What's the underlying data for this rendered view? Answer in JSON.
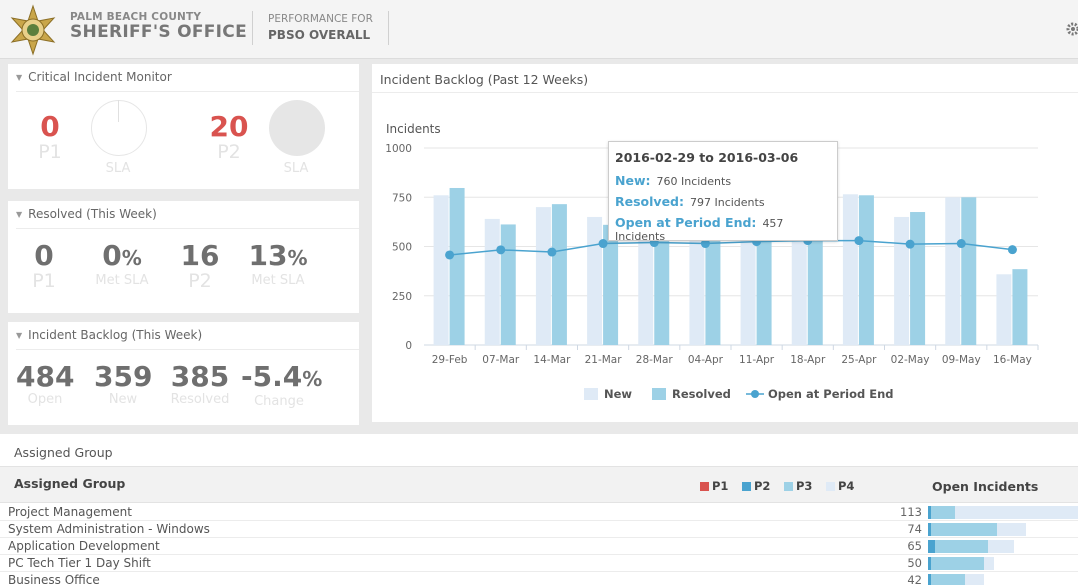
{
  "header": {
    "org_line1": "PALM BEACH COUNTY",
    "org_line2": "SHERIFF'S OFFICE",
    "perf_label": "PERFORMANCE FOR",
    "perf_value": "PBSO OVERALL"
  },
  "critical": {
    "title": "Critical Incident Monitor",
    "p1_value": "0",
    "p1_label": "P1",
    "p1_sla_label": "SLA",
    "p2_value": "20",
    "p2_label": "P2",
    "p2_sla_label": "SLA"
  },
  "resolved": {
    "title": "Resolved (This Week)",
    "p1_value": "0",
    "p1_label": "P1",
    "p1_sla_value": "0",
    "p1_sla_pct": "%",
    "p1_sla_label": "Met SLA",
    "p2_value": "16",
    "p2_label": "P2",
    "p2_sla_value": "13",
    "p2_sla_pct": "%",
    "p2_sla_label": "Met SLA"
  },
  "backlog": {
    "title": "Incident Backlog (This Week)",
    "open_value": "484",
    "open_label": "Open",
    "new_value": "359",
    "new_label": "New",
    "resolved_value": "385",
    "resolved_label": "Resolved",
    "change_value": "-5.4",
    "change_pct": "%",
    "change_label": "Change"
  },
  "chart_data": {
    "type": "bar",
    "title": "Incident Backlog (Past 12 Weeks)",
    "ylabel": "Incidents",
    "ylim": [
      0,
      1000
    ],
    "yticks": [
      "0",
      "250",
      "500",
      "750",
      "1000"
    ],
    "categories": [
      "29-Feb",
      "07-Mar",
      "14-Mar",
      "21-Mar",
      "28-Mar",
      "04-Apr",
      "11-Apr",
      "18-Apr",
      "25-Apr",
      "02-May",
      "09-May",
      "16-May"
    ],
    "series": [
      {
        "name": "New",
        "type": "bar",
        "color": "#dfeaf6",
        "values": [
          760,
          640,
          700,
          650,
          640,
          650,
          640,
          650,
          765,
          650,
          750,
          359
        ]
      },
      {
        "name": "Resolved",
        "type": "bar",
        "color": "#9dd1e6",
        "values": [
          797,
          612,
          715,
          610,
          600,
          670,
          655,
          620,
          760,
          675,
          750,
          385
        ]
      },
      {
        "name": "Open at Period End",
        "type": "line",
        "color": "#4aa3cf",
        "values": [
          457,
          483,
          472,
          515,
          520,
          515,
          525,
          530,
          530,
          512,
          515,
          484
        ]
      }
    ],
    "legend_position": "bottom",
    "tooltip": {
      "title": "2016-02-29 to 2016-03-06",
      "new_label": "New:",
      "new_text": "760 Incidents",
      "resolved_label": "Resolved:",
      "resolved_text": "797 Incidents",
      "open_label": "Open at Period End:",
      "open_text": "457 Incidents"
    }
  },
  "assigned": {
    "title": "Assigned Group",
    "col_group": "Assigned Group",
    "col_open": "Open Incidents",
    "legend": [
      {
        "label": "P1",
        "color": "#d9534f"
      },
      {
        "label": "P2",
        "color": "#4aa3cf"
      },
      {
        "label": "P3",
        "color": "#9dd1e6"
      },
      {
        "label": "P4",
        "color": "#dfeaf6"
      }
    ],
    "rows": [
      {
        "name": "Project Management",
        "count": "113",
        "p1": 0,
        "p2": 2,
        "p3": 18,
        "p4": 93
      },
      {
        "name": "System Administration - Windows",
        "count": "74",
        "p1": 0,
        "p2": 2,
        "p3": 50,
        "p4": 22
      },
      {
        "name": "Application Development",
        "count": "65",
        "p1": 0,
        "p2": 5,
        "p3": 40,
        "p4": 20
      },
      {
        "name": "PC Tech Tier 1 Day Shift",
        "count": "50",
        "p1": 0,
        "p2": 2,
        "p3": 40,
        "p4": 8
      },
      {
        "name": "Business Office",
        "count": "42",
        "p1": 0,
        "p2": 2,
        "p3": 26,
        "p4": 14
      }
    ]
  }
}
